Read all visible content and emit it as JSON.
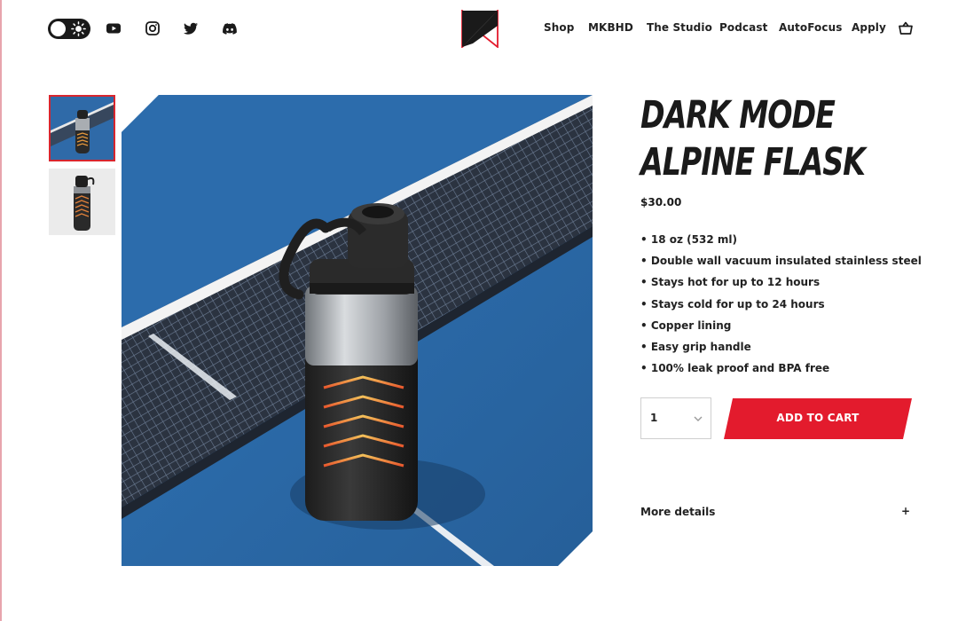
{
  "header": {
    "theme_toggle": {
      "state": "light"
    },
    "social_icons": [
      "youtube-icon",
      "instagram-icon",
      "twitter-icon",
      "discord-icon"
    ],
    "nav": [
      {
        "label": "Shop"
      },
      {
        "label": "MKBHD"
      },
      {
        "label": "The Studio"
      },
      {
        "label": "Podcast"
      },
      {
        "label": "AutoFocus"
      },
      {
        "label": "Apply"
      }
    ],
    "cart_icon": "cart-icon"
  },
  "gallery": {
    "thumbnails": [
      {
        "name": "thumbnail-lifestyle",
        "selected": true
      },
      {
        "name": "thumbnail-studio",
        "selected": false
      }
    ]
  },
  "product": {
    "title_line1": "DARK MODE",
    "title_line2": "ALPINE FLASK",
    "price": "$30.00",
    "features": [
      "18 oz (532 ml)",
      "Double wall vacuum insulated stainless steel",
      "Stays hot for up to 12 hours",
      "Stays cold for up to 24 hours",
      "Copper lining",
      "Easy grip handle",
      "100% leak proof and BPA free"
    ],
    "quantity": "1",
    "add_to_cart": "ADD TO CART",
    "more_details": "More details",
    "more_details_toggle": "+"
  },
  "colors": {
    "accent": "#e31b2d",
    "text": "#1a1a1a",
    "table_blue": "#2e6bab"
  }
}
